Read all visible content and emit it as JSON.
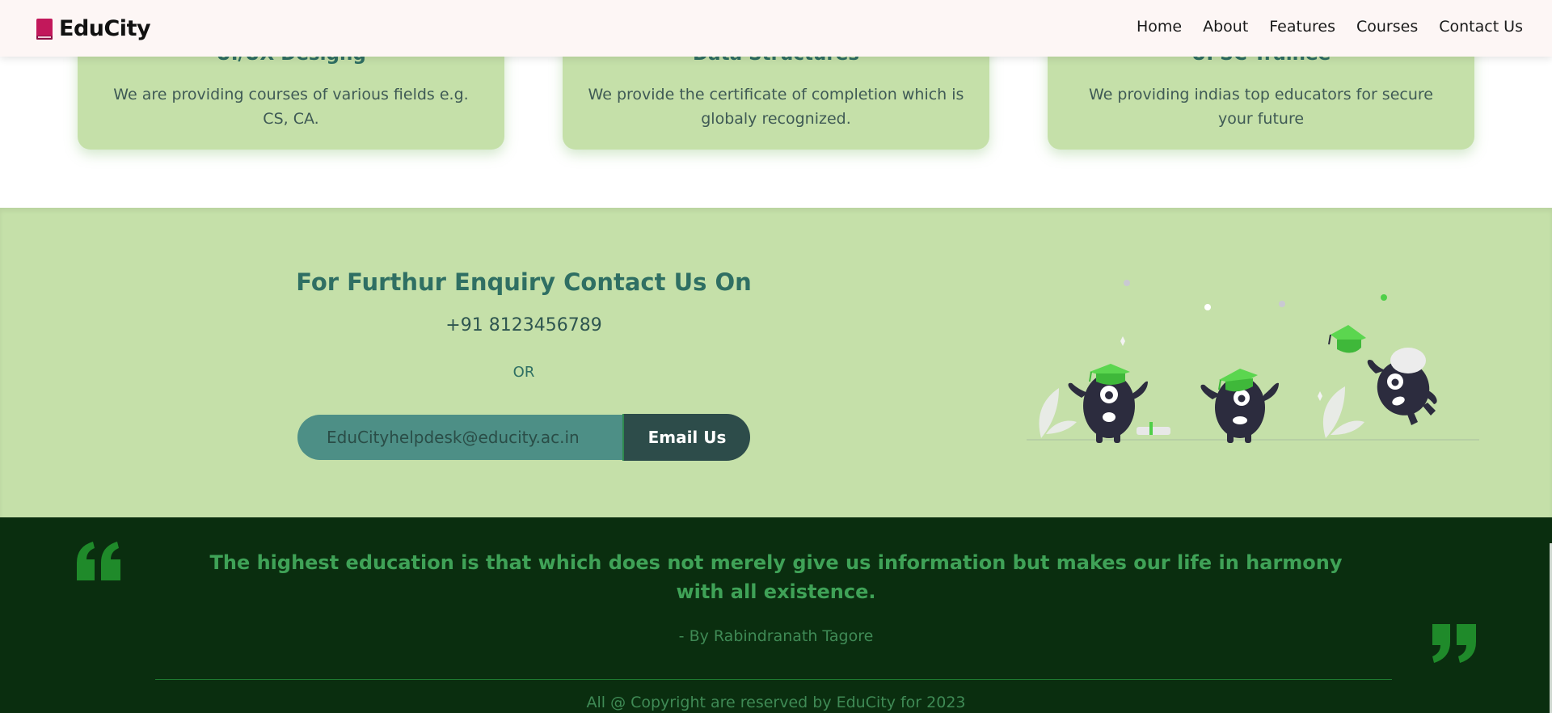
{
  "brand": {
    "name": "EduCity",
    "logo_color": "#c2185b"
  },
  "nav": {
    "items": [
      "Home",
      "About",
      "Features",
      "Courses",
      "Contact Us"
    ]
  },
  "cards": [
    {
      "title": "UI/UX Designg",
      "description": "We are providing courses of various fields e.g. CS, CA."
    },
    {
      "title": "Data Structures",
      "description": "We provide the certificate of completion which is globaly recognized."
    },
    {
      "title": "UPSC Trainee",
      "description": "We providing indias top educators for secure your future"
    }
  ],
  "contact": {
    "title": "For Furthur Enquiry Contact Us On",
    "phone": "+91 8123456789",
    "or": "OR",
    "email_value": "EduCityhelpdesk@educity.ac.in",
    "email_button": "Email Us"
  },
  "footer": {
    "quote": "The highest education is that which does not merely give us information but makes our life in harmony with all existence.",
    "author": "- By Rabindranath Tagore",
    "copyright": "All @ Copyright are reserved by EduCity for 2023"
  },
  "colors": {
    "card_bg": "#c5e0a9",
    "accent": "#2f6f63",
    "footer_bg": "#0a2e0f",
    "quote_green": "#3fa257",
    "button_dark": "#2d4c4a"
  }
}
